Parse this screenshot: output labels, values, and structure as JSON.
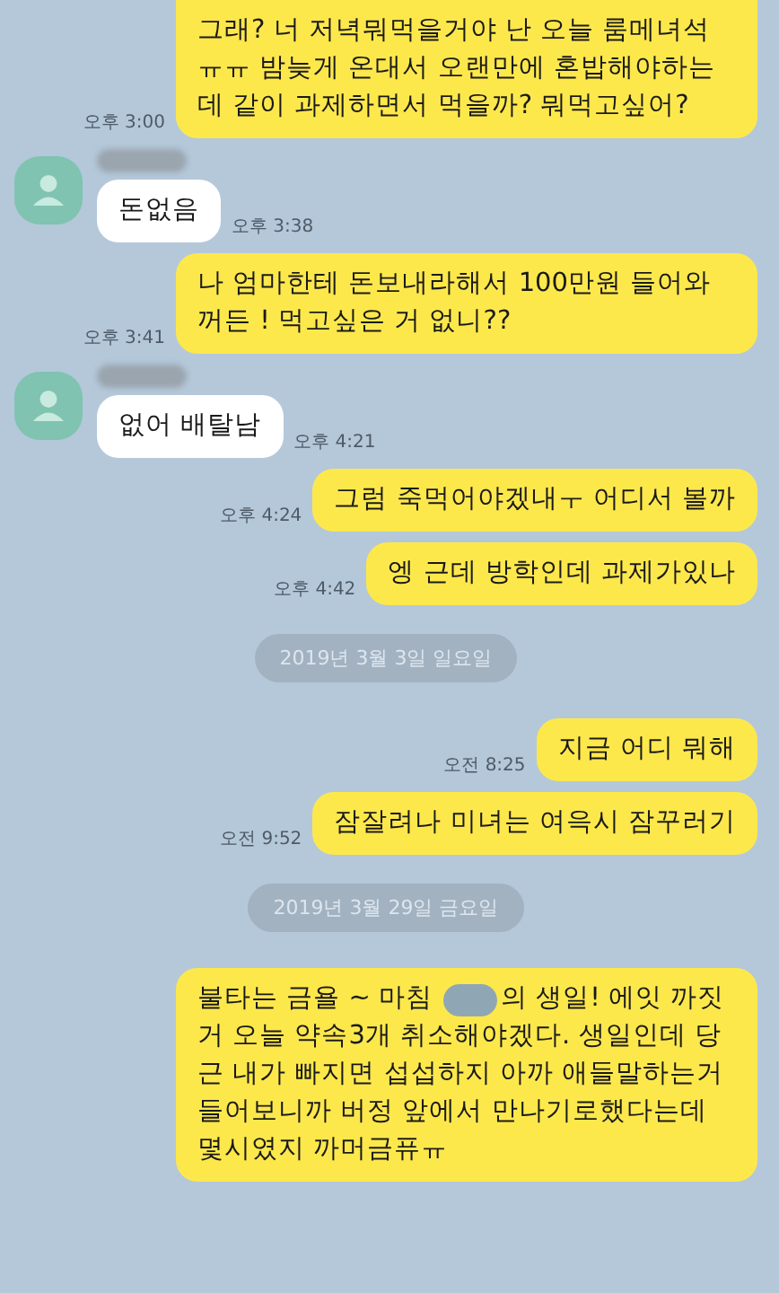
{
  "messages": [
    {
      "kind": "sent",
      "text": "그래? 너 저녁뭐먹을거야 난 오늘 룸메녀석 ㅠㅠ 밤늦게 온대서 오랜만에 혼밥해야하는데 같이 과제하면서 먹을까? 뭐먹고싶어?",
      "time": "오후 3:00"
    },
    {
      "kind": "received",
      "text": "돈없음",
      "time": "오후 3:38"
    },
    {
      "kind": "sent",
      "text": "나 엄마한테 돈보내라해서 100만원 들어와꺼든 ! 먹고싶은 거 없니??",
      "time": "오후 3:41"
    },
    {
      "kind": "received",
      "text": "없어 배탈남",
      "time": "오후 4:21"
    },
    {
      "kind": "sent",
      "text": "그럼 죽먹어야겠내ㅜ 어디서 볼까",
      "time": "오후 4:24"
    },
    {
      "kind": "sent",
      "text": "엥 근데 방학인데 과제가있나",
      "time": "오후 4:42"
    },
    {
      "kind": "date",
      "text": "2019년 3월 3일 일요일"
    },
    {
      "kind": "sent",
      "text": "지금 어디 뭐해",
      "time": "오전 8:25"
    },
    {
      "kind": "sent",
      "text": "잠잘려나 미녀는 여윽시 잠꾸러기",
      "time": "오전 9:52"
    },
    {
      "kind": "date",
      "text": "2019년 3월 29일 금요일"
    },
    {
      "kind": "redacted",
      "text_before": "불타는 금욜 ~ 마침",
      "text_after": "의 생일! 에잇 까짓",
      "text_rest": "거 오늘 약속3개 취소해야겠다. 생일인데 당근 내가 빠지면 섭섭하지 아까 애들말하는거 들어보니까 버정 앞에서 만나기로했다는데 몇시였지 까머금퓨ㅠ"
    }
  ]
}
